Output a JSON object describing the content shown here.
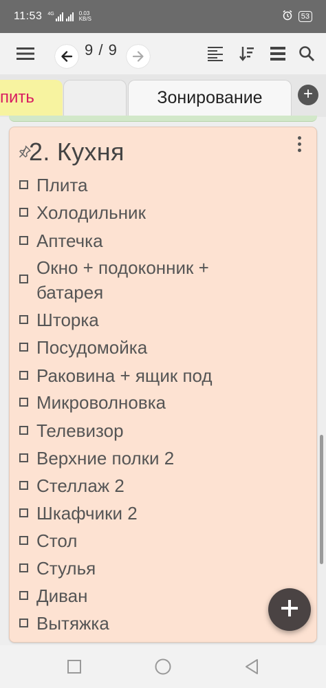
{
  "status_bar": {
    "time": "11:53",
    "network_speed_value": "0.03",
    "network_speed_unit": "KB/S",
    "network_type": "4G",
    "battery": "53",
    "icons": [
      "signal-icon",
      "alarm-icon",
      "battery-icon"
    ]
  },
  "toolbar": {
    "icons": [
      "menu-icon",
      "back-arrow-icon",
      "forward-arrow-icon",
      "align-left-icon",
      "sort-icon",
      "list-view-icon",
      "search-icon"
    ],
    "pager": "9 / 9"
  },
  "tabs": [
    {
      "label": "пить",
      "color": "#f7f3a0"
    },
    {
      "label": "",
      "color": "#efefef"
    },
    {
      "label": "Зонирование",
      "color": "#f7f7f7"
    }
  ],
  "tab_add_label": "+",
  "note": {
    "title": "2. Кухня",
    "background": "#fde2d2",
    "items": [
      "Плита",
      "Холодильник",
      "Аптечка",
      "Окно + подоконник + батарея",
      "Шторка",
      "Посудомойка",
      "Раковина + ящик под",
      "Микроволновка",
      "Телевизор",
      "Верхние полки 2",
      "Стеллаж 2",
      "Шкафчики 2",
      "Стол",
      "Стулья",
      "Диван",
      "Вытяжка"
    ]
  },
  "fab_label": "+"
}
